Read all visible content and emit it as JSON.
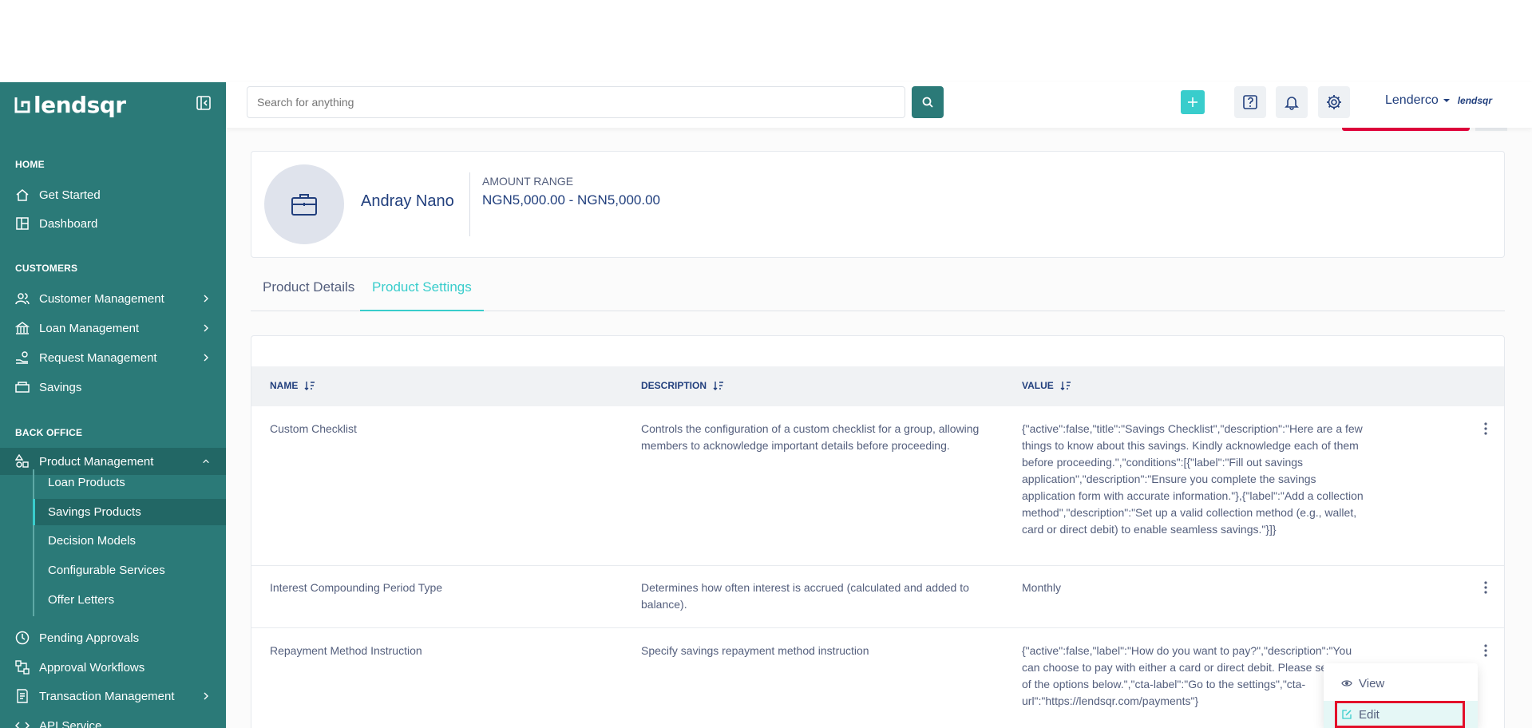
{
  "brand": {
    "logo_text": "lendsqr"
  },
  "sidebar": {
    "sections": [
      {
        "label": "HOME",
        "items": [
          {
            "label": "Get Started",
            "icon": "home-icon"
          },
          {
            "label": "Dashboard",
            "icon": "dashboard-icon"
          }
        ]
      },
      {
        "label": "CUSTOMERS",
        "items": [
          {
            "label": "Customer Management",
            "icon": "users-icon"
          },
          {
            "label": "Loan Management",
            "icon": "loan-icon"
          },
          {
            "label": "Request Management",
            "icon": "request-icon"
          },
          {
            "label": "Savings",
            "icon": "savings-icon"
          }
        ]
      },
      {
        "label": "BACK OFFICE",
        "items": [
          {
            "label": "Product Management",
            "icon": "product-icon"
          }
        ]
      }
    ],
    "sub_items": [
      "Loan Products",
      "Savings Products",
      "Decision Models",
      "Configurable Services",
      "Offer Letters"
    ],
    "more_items": [
      {
        "label": "Pending Approvals",
        "icon": "clock-icon"
      },
      {
        "label": "Approval Workflows",
        "icon": "workflow-icon"
      },
      {
        "label": "Transaction Management",
        "icon": "transaction-icon"
      },
      {
        "label": "API Service",
        "icon": "api-icon"
      }
    ]
  },
  "header": {
    "search_placeholder": "Search for anything",
    "user_name": "Lenderco",
    "user_logo": "lendsqr"
  },
  "product": {
    "name": "Andray Nano",
    "range_label": "AMOUNT RANGE",
    "range_value": "NGN5,000.00 - NGN5,000.00"
  },
  "tabs": [
    {
      "label": "Product Details"
    },
    {
      "label": "Product Settings"
    }
  ],
  "table": {
    "columns": [
      "NAME",
      "DESCRIPTION",
      "VALUE"
    ],
    "rows": [
      {
        "name": "Custom Checklist",
        "description": "Controls the configuration of a custom checklist for a group, allowing members to acknowledge important details before proceeding.",
        "value": "{\"active\":false,\"title\":\"Savings Checklist\",\"description\":\"Here are a few things to know about this savings. Kindly acknowledge each of them before proceeding.\",\"conditions\":[{\"label\":\"Fill out savings application\",\"description\":\"Ensure you complete the savings application form with accurate information.\"},{\"label\":\"Add a collection method\",\"description\":\"Set up a valid collection method (e.g., wallet, card or direct debit) to enable seamless savings.\"}]}"
      },
      {
        "name": "Interest Compounding Period Type",
        "description": "Determines how often interest is accrued (calculated and added to balance).",
        "value": "Monthly"
      },
      {
        "name": "Repayment Method Instruction",
        "description": "Specify savings repayment method instruction",
        "value": "{\"active\":false,\"label\":\"How do you want to pay?\",\"description\":\"You can choose to pay with either a card or direct debit. Please select one of the options below.\",\"cta-label\":\"Go to the settings\",\"cta-url\":\"https://lendsqr.com/payments\"}"
      }
    ]
  },
  "row_menu": {
    "view_label": "View",
    "edit_label": "Edit"
  },
  "colors": {
    "sidebar": "#2b7a78",
    "accent": "#39cdcc",
    "text": "#213f7d",
    "highlight": "#e30f2a"
  }
}
